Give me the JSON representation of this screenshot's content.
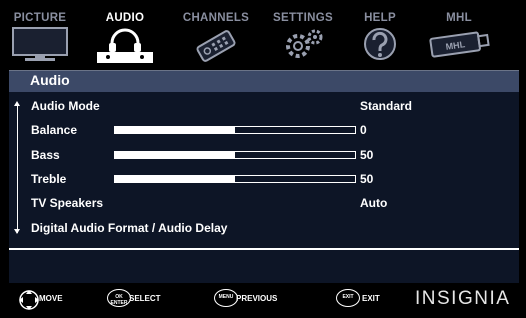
{
  "tabs": [
    {
      "label": "PICTURE",
      "icon": "tv-icon",
      "active": false
    },
    {
      "label": "AUDIO",
      "icon": "headphones-icon",
      "active": true
    },
    {
      "label": "CHANNELS",
      "icon": "remote-icon",
      "active": false
    },
    {
      "label": "SETTINGS",
      "icon": "gears-icon",
      "active": false
    },
    {
      "label": "HELP",
      "icon": "question-icon",
      "active": false
    },
    {
      "label": "MHL",
      "icon": "usb-mhl-icon",
      "active": false
    }
  ],
  "mhl_icon_text": "MHL",
  "menu": {
    "title": "Audio",
    "items": [
      {
        "label": "Audio Mode",
        "value": "Standard"
      },
      {
        "label": "Balance",
        "value": "0",
        "slider": 0.5
      },
      {
        "label": "Bass",
        "value": "50",
        "slider": 0.5
      },
      {
        "label": "Treble",
        "value": "50",
        "slider": 0.5
      },
      {
        "label": "TV Speakers",
        "value": "Auto"
      },
      {
        "label": "Digital Audio Format / Audio Delay",
        "value": ""
      }
    ]
  },
  "footer": {
    "move": "MOVE",
    "select_icon": "OK ENTER",
    "select": "SELECT",
    "menu_icon": "MENU",
    "previous": "PREVIOUS",
    "exit_icon": "EXIT",
    "exit": "EXIT",
    "brand": "INSIGNIA"
  },
  "colors": {
    "background": "#000000",
    "panel": "#0d1526",
    "title_bar": "#3c4967",
    "inactive_tab": "#8a8fa0",
    "text": "#ffffff"
  }
}
